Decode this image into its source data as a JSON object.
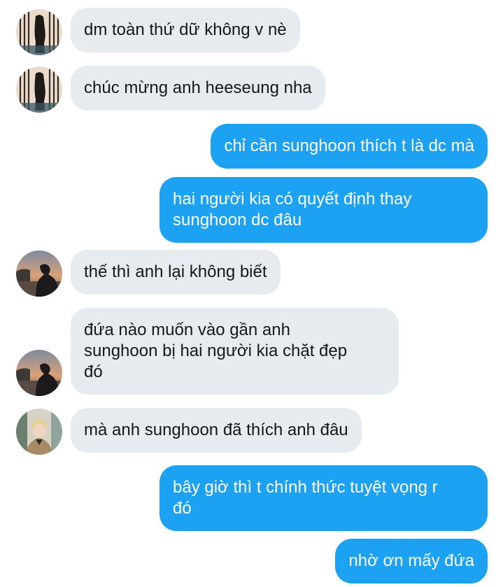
{
  "conversation": {
    "messages": [
      {
        "sender": "them",
        "avatar": "avatar-window-person",
        "text": "dm toàn thứ dữ không v nè"
      },
      {
        "sender": "them",
        "avatar": "avatar-window-person",
        "text": "chúc mừng anh heeseung nha"
      },
      {
        "sender": "me",
        "text": "chỉ cần sunghoon thích t là dc mà"
      },
      {
        "sender": "me",
        "text_lines": [
          "hai người kia có quyết định thay",
          "sunghoon dc đâu"
        ]
      },
      {
        "sender": "them",
        "avatar": "avatar-sunset-person",
        "text": "thế thì anh lại không biết"
      },
      {
        "sender": "them",
        "avatar": "avatar-sunset-person",
        "text_lines": [
          "đứa nào muốn vào gần anh",
          "sunghoon bị hai người kia chặt đẹp",
          "đó"
        ]
      },
      {
        "sender": "them",
        "avatar": "avatar-blond-person",
        "text": "mà anh sunghoon đã thích anh đâu"
      },
      {
        "sender": "me",
        "text_lines": [
          "bây giờ thì t chính thức tuyệt vọng r",
          "đó"
        ]
      },
      {
        "sender": "me",
        "text": "nhờ ơn mấy đứa"
      }
    ]
  },
  "colors": {
    "outgoing_bubble": "#1da1f2",
    "incoming_bubble": "#e6ebef",
    "incoming_text": "#16181a",
    "outgoing_text": "#ffffff"
  }
}
